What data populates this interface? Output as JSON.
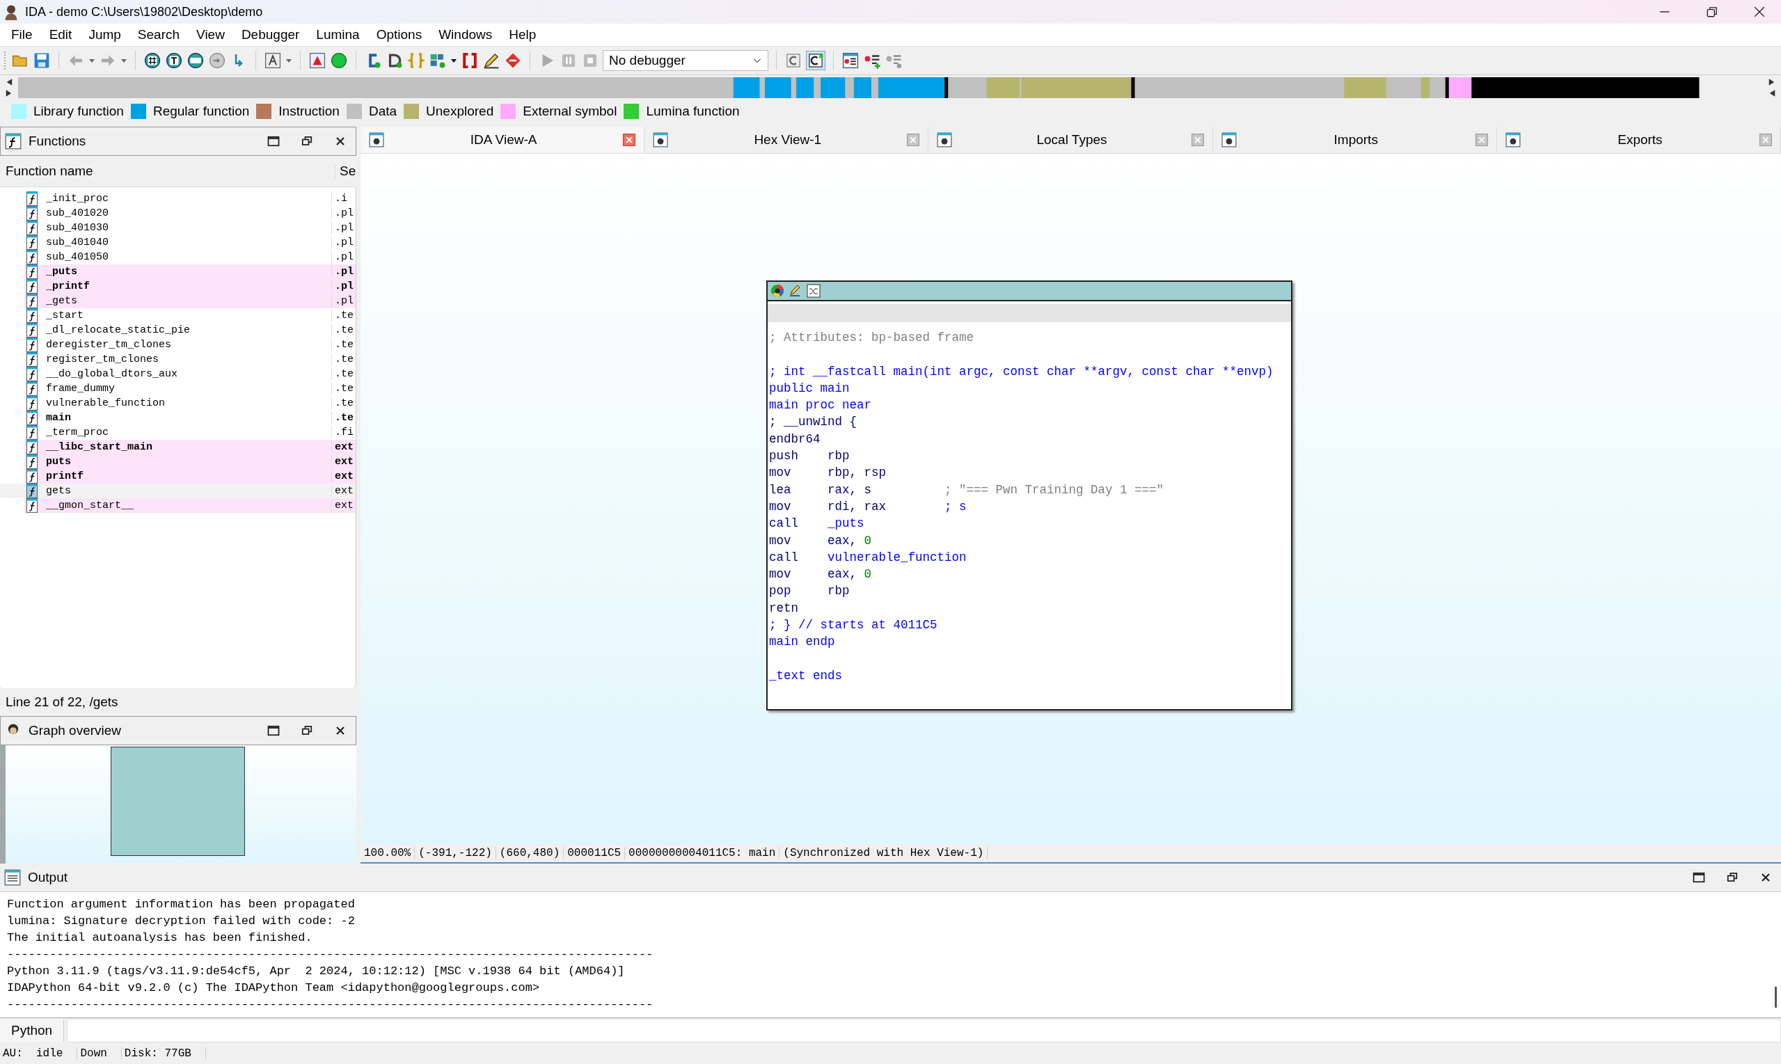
{
  "window": {
    "title": "IDA - demo C:\\Users\\19802\\Desktop\\demo"
  },
  "menu": [
    "File",
    "Edit",
    "Jump",
    "Search",
    "View",
    "Debugger",
    "Lumina",
    "Options",
    "Windows",
    "Help"
  ],
  "toolbar": {
    "debugger_select": {
      "value": "No debugger"
    }
  },
  "legend": [
    {
      "label": "Library function",
      "color": "#aaf8ff"
    },
    {
      "label": "Regular function",
      "color": "#00a0e6"
    },
    {
      "label": "Instruction",
      "color": "#b57a5a"
    },
    {
      "label": "Data",
      "color": "#c0c0c0"
    },
    {
      "label": "Unexplored",
      "color": "#b5b56e"
    },
    {
      "label": "External symbol",
      "color": "#ffaaff"
    },
    {
      "label": "Lumina function",
      "color": "#33cc33"
    }
  ],
  "functions_panel": {
    "title": "Functions",
    "columns": [
      "Function name",
      "Se"
    ],
    "rows": [
      {
        "name": "_init_proc",
        "segment": ".i",
        "bold": false,
        "external": false,
        "selected": false
      },
      {
        "name": "sub_401020",
        "segment": ".pl",
        "bold": false,
        "external": false,
        "selected": false
      },
      {
        "name": "sub_401030",
        "segment": ".pl",
        "bold": false,
        "external": false,
        "selected": false
      },
      {
        "name": "sub_401040",
        "segment": ".pl",
        "bold": false,
        "external": false,
        "selected": false
      },
      {
        "name": "sub_401050",
        "segment": ".pl",
        "bold": false,
        "external": false,
        "selected": false
      },
      {
        "name": "_puts",
        "segment": ".pl",
        "bold": true,
        "external": true,
        "selected": false
      },
      {
        "name": "_printf",
        "segment": ".pl",
        "bold": true,
        "external": true,
        "selected": false
      },
      {
        "name": "_gets",
        "segment": ".pl",
        "bold": false,
        "external": true,
        "selected": false
      },
      {
        "name": "_start",
        "segment": ".te",
        "bold": false,
        "external": false,
        "selected": false
      },
      {
        "name": "_dl_relocate_static_pie",
        "segment": ".te",
        "bold": false,
        "external": false,
        "selected": false
      },
      {
        "name": "deregister_tm_clones",
        "segment": ".te",
        "bold": false,
        "external": false,
        "selected": false
      },
      {
        "name": "register_tm_clones",
        "segment": ".te",
        "bold": false,
        "external": false,
        "selected": false
      },
      {
        "name": "__do_global_dtors_aux",
        "segment": ".te",
        "bold": false,
        "external": false,
        "selected": false
      },
      {
        "name": "frame_dummy",
        "segment": ".te",
        "bold": false,
        "external": false,
        "selected": false
      },
      {
        "name": "vulnerable_function",
        "segment": ".te",
        "bold": false,
        "external": false,
        "selected": false
      },
      {
        "name": "main",
        "segment": ".te",
        "bold": true,
        "external": false,
        "selected": false
      },
      {
        "name": "_term_proc",
        "segment": ".fi",
        "bold": false,
        "external": false,
        "selected": false
      },
      {
        "name": "__libc_start_main",
        "segment": "ext",
        "bold": true,
        "external": true,
        "selected": false
      },
      {
        "name": "puts",
        "segment": "ext",
        "bold": true,
        "external": true,
        "selected": false
      },
      {
        "name": "printf",
        "segment": "ext",
        "bold": true,
        "external": true,
        "selected": false
      },
      {
        "name": "gets",
        "segment": "ext",
        "bold": false,
        "external": false,
        "selected": true
      },
      {
        "name": "__gmon_start__",
        "segment": "ext",
        "bold": false,
        "external": true,
        "selected": false
      }
    ],
    "status": "Line 21 of 22, /gets"
  },
  "graph_overview": {
    "title": "Graph overview"
  },
  "tabs": [
    {
      "label": "IDA View-A",
      "selected": true
    },
    {
      "label": "Hex View-1",
      "selected": false
    },
    {
      "label": "Local Types",
      "selected": false
    },
    {
      "label": "Imports",
      "selected": false
    },
    {
      "label": "Exports",
      "selected": false
    }
  ],
  "disassembly": {
    "lines": [
      {
        "kind": "comment",
        "text": "; Attributes: bp-based frame"
      },
      {
        "kind": "blank"
      },
      {
        "kind": "directive",
        "text": "; int __fastcall main(int argc, const char **argv, const char **envp)"
      },
      {
        "kind": "directive",
        "text": "public main"
      },
      {
        "kind": "directive",
        "text": "main proc near"
      },
      {
        "kind": "plain",
        "text": "; __unwind {"
      },
      {
        "kind": "insn",
        "mnemonic": "endbr64"
      },
      {
        "kind": "insn",
        "mnemonic": "push",
        "operands": [
          {
            "text": "rbp",
            "kind": "reg"
          }
        ]
      },
      {
        "kind": "insn",
        "mnemonic": "mov",
        "operands": [
          {
            "text": "rbp, rsp",
            "kind": "reg"
          }
        ]
      },
      {
        "kind": "insn",
        "mnemonic": "lea",
        "operands": [
          {
            "text": "rax, s",
            "kind": "reg"
          }
        ],
        "comment": {
          "text": "; \"=== Pwn Training Day 1 ===\"",
          "kind": "string"
        }
      },
      {
        "kind": "insn",
        "mnemonic": "mov",
        "operands": [
          {
            "text": "rdi, rax",
            "kind": "reg"
          }
        ],
        "comment": {
          "text": "; s",
          "kind": "name"
        }
      },
      {
        "kind": "insn",
        "mnemonic": "call",
        "operands": [
          {
            "text": "_puts",
            "kind": "name"
          }
        ]
      },
      {
        "kind": "insn",
        "mnemonic": "mov",
        "operands": [
          {
            "text": "eax, ",
            "kind": "reg"
          },
          {
            "text": "0",
            "kind": "number"
          }
        ]
      },
      {
        "kind": "insn",
        "mnemonic": "call",
        "operands": [
          {
            "text": "vulnerable_function",
            "kind": "name"
          }
        ]
      },
      {
        "kind": "insn",
        "mnemonic": "mov",
        "operands": [
          {
            "text": "eax, ",
            "kind": "reg"
          },
          {
            "text": "0",
            "kind": "number"
          }
        ]
      },
      {
        "kind": "insn",
        "mnemonic": "pop",
        "operands": [
          {
            "text": "rbp",
            "kind": "reg"
          }
        ]
      },
      {
        "kind": "insn",
        "mnemonic": "retn"
      },
      {
        "kind": "directive",
        "text": "; } // starts at 4011C5"
      },
      {
        "kind": "directive",
        "text": "main endp"
      },
      {
        "kind": "blank"
      },
      {
        "kind": "directive",
        "text": "_text ends"
      }
    ]
  },
  "view_status": [
    "100.00%",
    "(-391,-122)",
    "(660,480)",
    "000011C5",
    "00000000004011C5: main",
    "(Synchronized with Hex View-1)"
  ],
  "output": {
    "title": "Output",
    "lines": [
      "Function argument information has been propagated",
      "lumina: Signature decryption failed with code: -2",
      "The initial autoanalysis has been finished.",
      "-------------------------------------------------------------------------------------------",
      "Python 3.11.9 (tags/v3.11.9:de54cf5, Apr  2 2024, 10:12:12) [MSC v.1938 64 bit (AMD64)]",
      "IDAPython 64-bit v9.2.0 (c) The IDAPython Team <idapython@googlegroups.com>",
      "-------------------------------------------------------------------------------------------"
    ],
    "input_label": "Python"
  },
  "status_bar": [
    "AU:  idle",
    "Down",
    "Disk: 77GB"
  ]
}
